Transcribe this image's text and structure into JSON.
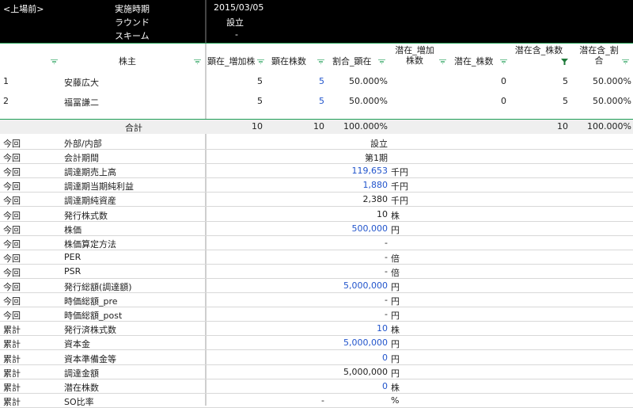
{
  "header": {
    "back_label": "<上場前>",
    "labels": [
      "実施時期",
      "ラウンド",
      "スキーム"
    ],
    "values": [
      "2015/03/05",
      "設立",
      "-"
    ]
  },
  "columns": [
    {
      "label": "株主"
    },
    {
      "label": "顕在_増加株"
    },
    {
      "label": "顕在株数"
    },
    {
      "label": "割合_顕在"
    },
    {
      "label": "潜在_増加株数"
    },
    {
      "label": "潜在_株数"
    },
    {
      "label": "潜在含_株数"
    },
    {
      "label": "潜在含_割合"
    }
  ],
  "shareholders": [
    {
      "no": "1",
      "name": "安藤広大",
      "inc": "5",
      "shares": "5",
      "ratio": "50.000%",
      "pot_shares": "0",
      "pot_total": "5",
      "pot_ratio": "50.000%"
    },
    {
      "no": "2",
      "name": "福冨謙二",
      "inc": "5",
      "shares": "5",
      "ratio": "50.000%",
      "pot_shares": "0",
      "pot_total": "5",
      "pot_ratio": "50.000%"
    }
  ],
  "totals": {
    "label": "合計",
    "inc": "10",
    "shares": "10",
    "ratio": "100.000%",
    "pot_total": "10",
    "pot_ratio": "100.000%"
  },
  "details": [
    {
      "scope": "今回",
      "label": "外部/内部",
      "value": "設立",
      "unit": ""
    },
    {
      "scope": "今回",
      "label": "会計期間",
      "value": "第1期",
      "unit": ""
    },
    {
      "scope": "今回",
      "label": "調達期売上高",
      "value": "119,653",
      "unit": "千円"
    },
    {
      "scope": "今回",
      "label": "調達期当期純利益",
      "value": "1,880",
      "unit": "千円"
    },
    {
      "scope": "今回",
      "label": "調達期純資産",
      "value": "2,380",
      "unit": "千円"
    },
    {
      "scope": "今回",
      "label": "発行株式数",
      "value": "10",
      "unit": "株"
    },
    {
      "scope": "今回",
      "label": "株価",
      "value": "500,000",
      "unit": "円"
    },
    {
      "scope": "今回",
      "label": "株価算定方法",
      "value": "-",
      "unit": ""
    },
    {
      "scope": "今回",
      "label": "PER",
      "value": "-",
      "unit": "倍"
    },
    {
      "scope": "今回",
      "label": "PSR",
      "value": "-",
      "unit": "倍"
    },
    {
      "scope": "今回",
      "label": "発行総額(調達額)",
      "value": "5,000,000",
      "unit": "円"
    },
    {
      "scope": "今回",
      "label": "時価総額_pre",
      "value": "-",
      "unit": "円"
    },
    {
      "scope": "今回",
      "label": "時価総額_post",
      "value": "-",
      "unit": "円"
    },
    {
      "scope": "累計",
      "label": "発行済株式数",
      "value": "10",
      "unit": "株"
    },
    {
      "scope": "累計",
      "label": "資本金",
      "value": "5,000,000",
      "unit": "円"
    },
    {
      "scope": "累計",
      "label": "資本準備金等",
      "value": "0",
      "unit": "円"
    },
    {
      "scope": "累計",
      "label": "調達金額",
      "value": "5,000,000",
      "unit": "円"
    },
    {
      "scope": "累計",
      "label": "潜在株数",
      "value": "0",
      "unit": "株"
    },
    {
      "scope": "累計",
      "label": "SO比率",
      "value": "-",
      "unit": "%"
    }
  ],
  "colors": {
    "accent": "#1f9d55",
    "link_blue": "#2255cc",
    "header_bg": "#000000"
  }
}
